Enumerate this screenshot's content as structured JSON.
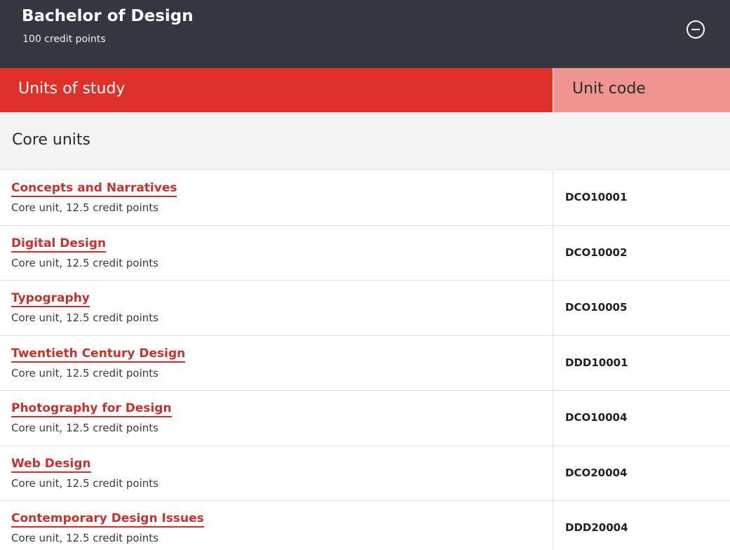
{
  "course": {
    "title": "Bachelor of Design",
    "credits": "100 credit points",
    "collapse_icon": "minus-circle-icon"
  },
  "table": {
    "col_units": "Units of study",
    "col_code": "Unit code",
    "section": "Core units",
    "rows": [
      {
        "name": "Concepts and Narratives",
        "meta": "Core unit, 12.5 credit points",
        "code": "DCO10001"
      },
      {
        "name": "Digital Design",
        "meta": "Core unit, 12.5 credit points",
        "code": "DCO10002"
      },
      {
        "name": "Typography",
        "meta": "Core unit, 12.5 credit points",
        "code": "DCO10005"
      },
      {
        "name": "Twentieth Century Design",
        "meta": "Core unit, 12.5 credit points",
        "code": "DDD10001"
      },
      {
        "name": "Photography for Design",
        "meta": "Core unit, 12.5 credit points",
        "code": "DCO10004"
      },
      {
        "name": "Web Design",
        "meta": "Core unit, 12.5 credit points",
        "code": "DCO20004"
      },
      {
        "name": "Contemporary Design Issues",
        "meta": "Core unit, 12.5 credit points",
        "code": "DDD20004"
      }
    ]
  },
  "colors": {
    "header_bg": "#343640",
    "accent_red": "#e0302a",
    "code_header_bg": "#ee9590",
    "link_red": "#c8322c"
  }
}
